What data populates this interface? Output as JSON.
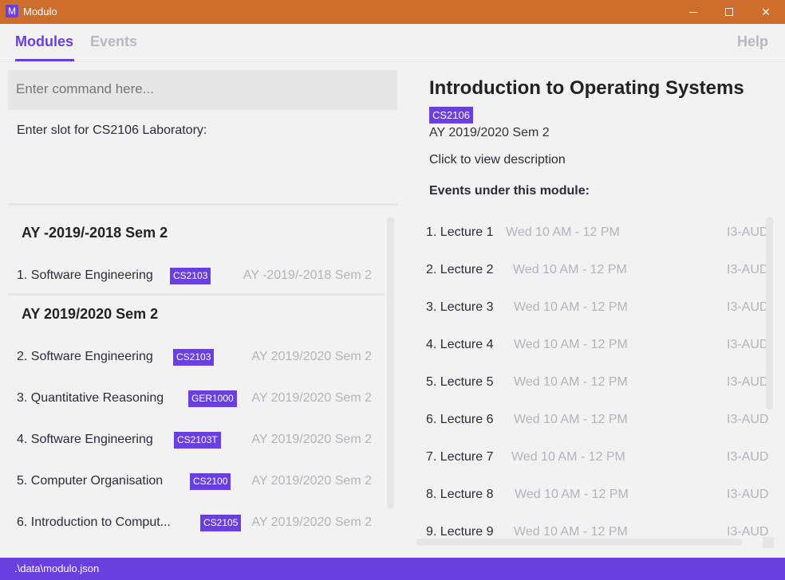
{
  "window": {
    "title": "Modulo",
    "app_icon_letter": "M"
  },
  "tabs": {
    "modules": "Modules",
    "events": "Events",
    "help": "Help"
  },
  "command": {
    "placeholder": "Enter command here...",
    "result": "Enter slot for CS2106 Laboratory:"
  },
  "module_list": {
    "groups": [
      {
        "title": "AY -2019/-2018 Sem 2",
        "items": [
          {
            "name": "1. Software Engineering",
            "code": "CS2103",
            "semester": "AY -2019/-2018 Sem 2"
          }
        ]
      },
      {
        "title": "AY 2019/2020 Sem 2",
        "items": [
          {
            "name": "2. Software Engineering",
            "code": "CS2103",
            "semester": "AY 2019/2020 Sem 2"
          },
          {
            "name": "3. Quantitative Reasoning",
            "code": "GER1000",
            "semester": "AY 2019/2020 Sem 2"
          },
          {
            "name": "4. Software Engineering",
            "code": "CS2103T",
            "semester": "AY 2019/2020 Sem 2"
          },
          {
            "name": "5. Computer Organisation",
            "code": "CS2100",
            "semester": "AY 2019/2020 Sem 2"
          },
          {
            "name": "6. Introduction to Comput...",
            "code": "CS2105",
            "semester": "AY 2019/2020 Sem 2"
          }
        ]
      }
    ]
  },
  "detail": {
    "title": "Introduction to Operating Systems",
    "code": "CS2106",
    "semester": "AY 2019/2020 Sem 2",
    "description_link": "Click to view description",
    "events_heading": "Events under this module:",
    "events": [
      {
        "name": "1. Lecture 1",
        "time": "Wed 10 AM - 12 PM",
        "location": "I3-AUD"
      },
      {
        "name": "2. Lecture 2",
        "time": "Wed 10 AM - 12 PM",
        "location": "I3-AUD"
      },
      {
        "name": "3. Lecture 3",
        "time": "Wed 10 AM - 12 PM",
        "location": "I3-AUD"
      },
      {
        "name": "4. Lecture 4",
        "time": "Wed 10 AM - 12 PM",
        "location": "I3-AUD"
      },
      {
        "name": "5. Lecture 5",
        "time": "Wed 10 AM - 12 PM",
        "location": "I3-AUD"
      },
      {
        "name": "6. Lecture 6",
        "time": "Wed 10 AM - 12 PM",
        "location": "I3-AUD"
      },
      {
        "name": "7. Lecture 7",
        "time": "Wed 10 AM - 12 PM",
        "location": "I3-AUD"
      },
      {
        "name": "8. Lecture 8",
        "time": "Wed 10 AM - 12 PM",
        "location": "I3-AUD"
      },
      {
        "name": "9. Lecture 9",
        "time": "Wed 10 AM - 12 PM",
        "location": "I3-AUD"
      }
    ]
  },
  "status": {
    "path": ".\\data\\modulo.json"
  },
  "colors": {
    "titlebar": "#cf6e2c",
    "accent": "#6a3fe0",
    "muted": "#b3b3bd"
  }
}
